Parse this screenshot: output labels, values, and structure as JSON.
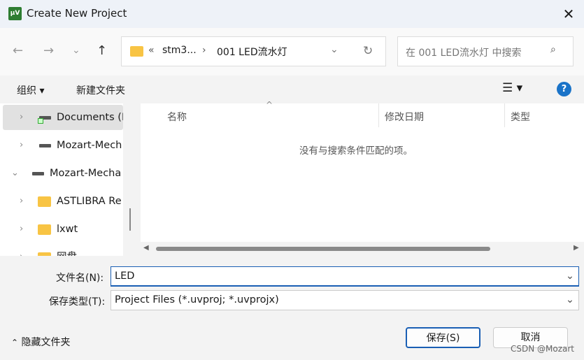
{
  "window": {
    "title": "Create New Project",
    "app_icon": "keil-uvision-icon"
  },
  "nav": {
    "back": "←",
    "forward": "→",
    "recent": "⌄",
    "up": "↑"
  },
  "address": {
    "overflow": "«",
    "crumbs": [
      "stm3...",
      "001 LED流水灯"
    ],
    "separator": "›"
  },
  "search": {
    "placeholder": "在 001 LED流水灯 中搜索"
  },
  "toolbar": {
    "organize": "组织 ▾",
    "new_folder": "新建文件夹",
    "help": "?"
  },
  "tree": [
    {
      "label": "Documents (E",
      "expanded": false,
      "selected": true,
      "icon": "network-drive-icon"
    },
    {
      "label": "Mozart-Mech",
      "expanded": false,
      "icon": "drive-icon"
    },
    {
      "label": "Mozart-Mecha",
      "expanded": true,
      "icon": "drive-icon"
    },
    {
      "label": "ASTLIBRA Re",
      "expanded": false,
      "icon": "folder-icon"
    },
    {
      "label": "lxwt",
      "expanded": false,
      "icon": "folder-icon"
    },
    {
      "label": "网盘",
      "expanded": false,
      "icon": "folder-icon"
    }
  ],
  "columns": [
    "名称",
    "修改日期",
    "类型"
  ],
  "empty_message": "没有与搜索条件匹配的项。",
  "form": {
    "filename_label": "文件名(N):",
    "filename_value": "LED",
    "filetype_label": "保存类型(T):",
    "filetype_value": "Project Files (*.uvproj; *.uvprojx)"
  },
  "footer": {
    "hide_folders": "隐藏文件夹",
    "save": "保存(S)",
    "cancel": "取消",
    "watermark": "CSDN @Mozart"
  }
}
